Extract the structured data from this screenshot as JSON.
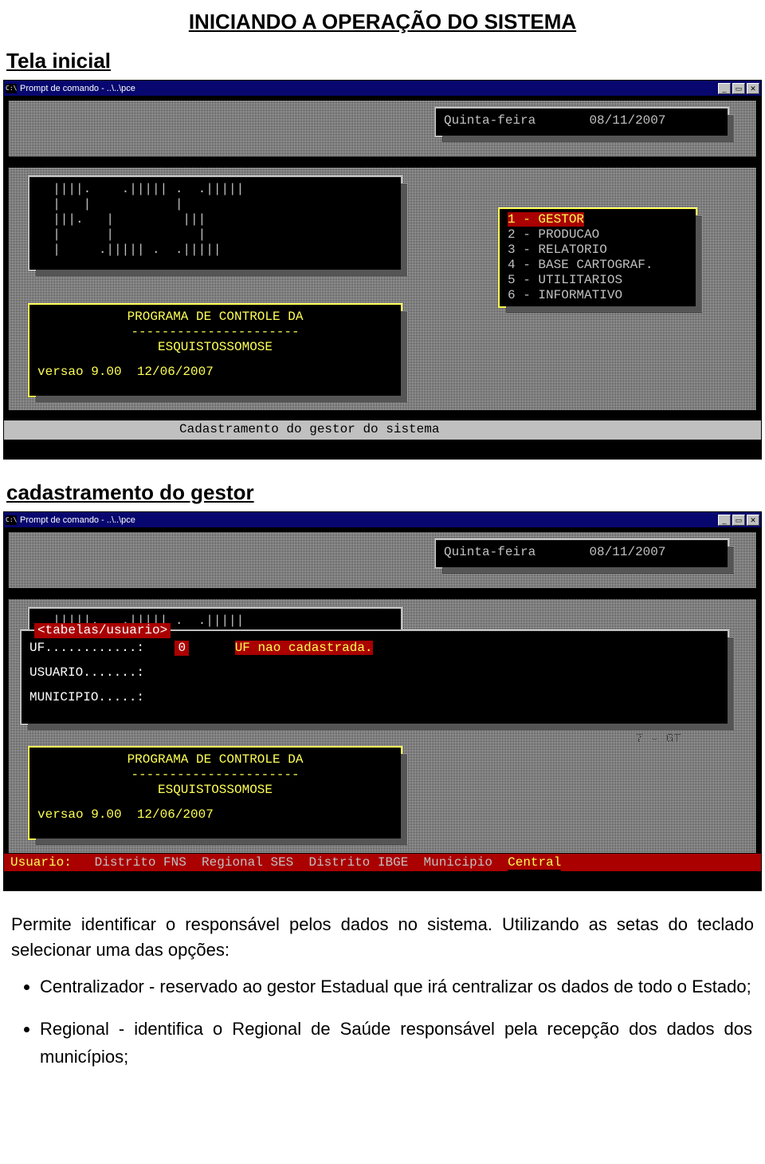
{
  "doc": {
    "title": "INICIANDO A OPERAÇÃO DO SISTEMA",
    "section1": "Tela inicial",
    "section2": "cadastramento do gestor",
    "para1": "Permite identificar o responsável pelos dados no sistema. Utilizando as setas do teclado selecionar uma das opções:",
    "bullet1": "Centralizador - reservado ao gestor Estadual que irá centralizar os dados de todo o Estado;",
    "bullet2": "Regional - identifica o Regional de Saúde responsável pela recepção dos dados dos municípios;"
  },
  "win": {
    "title": "Prompt de comando - ..\\..\\pce",
    "cmd_glyph": "C:\\"
  },
  "screen1": {
    "date_day": "Quinta-feira",
    "date_val": "08/11/2007",
    "program": {
      "l1": "PROGRAMA DE CONTROLE DA",
      "l2": "----------------------",
      "l3": "ESQUISTOSSOMOSE",
      "l4": "versao 9.00  12/06/2007"
    },
    "menu": [
      {
        "n": "1",
        "label": "GESTOR",
        "selected": true
      },
      {
        "n": "2",
        "label": "PRODUCAO"
      },
      {
        "n": "3",
        "label": "RELATORIO"
      },
      {
        "n": "4",
        "label": "BASE CARTOGRAF."
      },
      {
        "n": "5",
        "label": "UTILITARIOS"
      },
      {
        "n": "6",
        "label": "INFORMATIVO"
      }
    ],
    "status": "Cadastramento do gestor do sistema"
  },
  "screen2": {
    "date_day": "Quinta-feira",
    "date_val": "08/11/2007",
    "tab_header": "<tabelas/usuario>",
    "fields": {
      "uf_label": "UF............:",
      "uf_value": "0",
      "uf_msg": "UF nao cadastrada.",
      "usuario_label": "USUARIO.......:",
      "municipio_label": "MUNICIPIO.....:"
    },
    "menu7": "7 - GT",
    "program": {
      "l1": "PROGRAMA DE CONTROLE DA",
      "l2": "----------------------",
      "l3": "ESQUISTOSSOMOSE",
      "l4": "versao 9.00  12/06/2007"
    },
    "bottom": {
      "label": "Usuario:",
      "opts": [
        "Distrito FNS",
        "Regional SES",
        "Distrito IBGE",
        "Municipio",
        "Central"
      ]
    }
  }
}
